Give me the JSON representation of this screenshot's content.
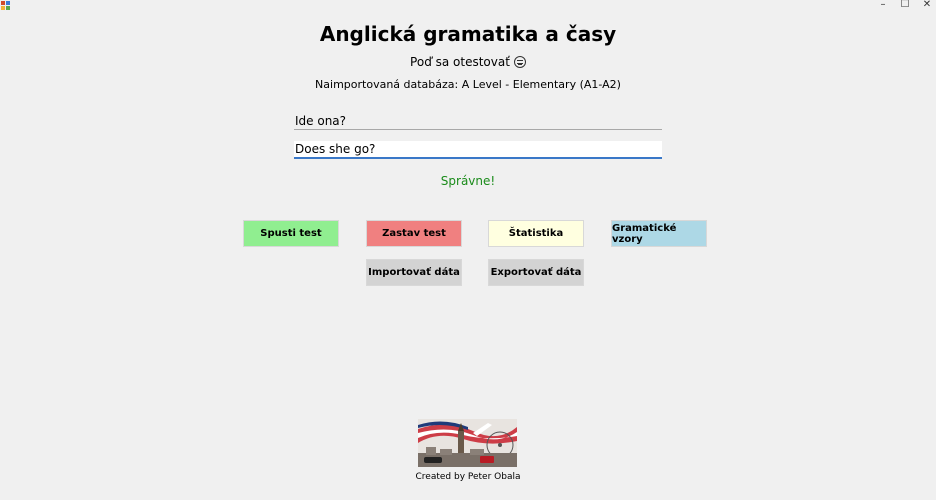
{
  "window": {
    "minimize_glyph": "–",
    "maximize_glyph": "☐",
    "close_glyph": "✕"
  },
  "header": {
    "title": "Anglická gramatika a časy",
    "subtitle": "Poď sa otestovať",
    "subtitle_icon": "nerd-face-icon",
    "database_info": "Naimportovaná databáza: A Level - Elementary (A1-A2)"
  },
  "quiz": {
    "question": "Ide ona?",
    "answer": "Does she go?",
    "feedback": "Správne!",
    "feedback_color": "#1a8b1a"
  },
  "buttons": {
    "start": "Spusti test",
    "stop": "Zastav test",
    "stats": "Štatistika",
    "grammar": "Gramatické vzory",
    "import": "Importovať dáta",
    "export": "Exportovať dáta"
  },
  "colors": {
    "start": "#90ee90",
    "stop": "#f08080",
    "stats": "#ffffe0",
    "grammar": "#add8e6",
    "neutral": "#d3d3d3",
    "focus_underline": "#3a78c8"
  },
  "footer": {
    "logo_icon": "london-union-jack-logo",
    "credit": "Created by Peter Obala"
  }
}
